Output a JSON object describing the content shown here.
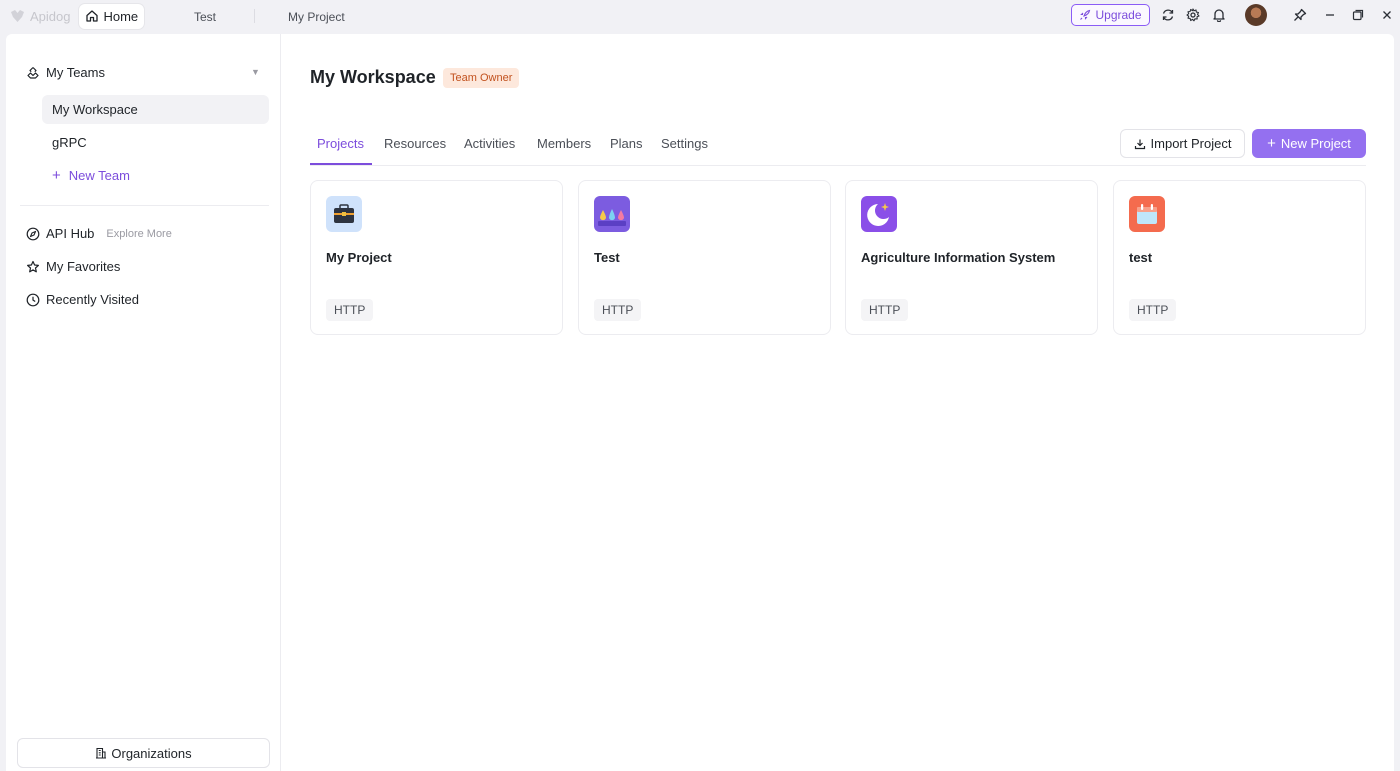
{
  "titlebar": {
    "logo_text": "Apidog",
    "tabs": [
      {
        "label": "Home",
        "icon": "home-icon"
      },
      {
        "label": "Test"
      },
      {
        "label": "My Project"
      }
    ],
    "upgrade_label": "Upgrade",
    "icons": [
      "refresh-icon",
      "gear-icon",
      "bell-icon",
      "avatar",
      "pin-icon",
      "minimize-icon",
      "restore-icon",
      "close-icon"
    ]
  },
  "sidebar": {
    "teams_label": "My Teams",
    "teams": [
      {
        "label": "My Workspace",
        "selected": true
      },
      {
        "label": "gRPC",
        "selected": false
      }
    ],
    "new_team_label": "New Team",
    "api_hub_label": "API Hub",
    "explore_label": "Explore More",
    "favorites_label": "My Favorites",
    "recent_label": "Recently Visited",
    "organizations_label": "Organizations"
  },
  "main": {
    "title": "My Workspace",
    "role_badge": "Team Owner",
    "tabs": [
      {
        "label": "Projects",
        "active": true
      },
      {
        "label": "Resources"
      },
      {
        "label": "Activities"
      },
      {
        "label": "Members"
      },
      {
        "label": "Plans"
      },
      {
        "label": "Settings"
      }
    ],
    "import_label": "Import Project",
    "new_project_label": "New Project",
    "projects": [
      {
        "name": "My Project",
        "type": "HTTP",
        "icon": "briefcase-icon"
      },
      {
        "name": "Test",
        "type": "HTTP",
        "icon": "droplets-icon"
      },
      {
        "name": "Agriculture Information System",
        "type": "HTTP",
        "icon": "moon-icon"
      },
      {
        "name": "test",
        "type": "HTTP",
        "icon": "calendar-icon"
      }
    ]
  },
  "colors": {
    "accent": "#7c4ddc",
    "primary_button": "#9470f0",
    "badge_bg": "#fde8dc",
    "badge_text": "#c2521f"
  }
}
